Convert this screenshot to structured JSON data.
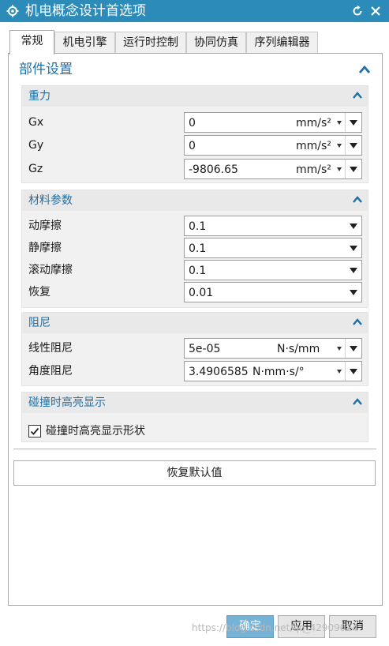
{
  "window": {
    "title": "机电概念设计首选项"
  },
  "tabs": [
    {
      "label": "常规"
    },
    {
      "label": "机电引擎"
    },
    {
      "label": "运行时控制"
    },
    {
      "label": "协同仿真"
    },
    {
      "label": "序列编辑器"
    }
  ],
  "active_tab": "常规",
  "section": {
    "title": "部件设置"
  },
  "gravity": {
    "title": "重力",
    "rows": [
      {
        "label": "Gx",
        "value": "0",
        "unit": "mm/s²"
      },
      {
        "label": "Gy",
        "value": "0",
        "unit": "mm/s²"
      },
      {
        "label": "Gz",
        "value": "-9806.65",
        "unit": "mm/s²"
      }
    ]
  },
  "material": {
    "title": "材料参数",
    "rows": [
      {
        "label": "动摩擦",
        "value": "0.1"
      },
      {
        "label": "静摩擦",
        "value": "0.1"
      },
      {
        "label": "滚动摩擦",
        "value": "0.1"
      },
      {
        "label": "恢复",
        "value": "0.01"
      }
    ]
  },
  "damping": {
    "title": "阻尼",
    "rows": [
      {
        "label": "线性阻尼",
        "value": "5e-05",
        "unit": "N·s/mm"
      },
      {
        "label": "角度阻尼",
        "value": "3.4906585",
        "unit": "N·mm·s/°"
      }
    ]
  },
  "collision": {
    "title": "碰撞时高亮显示",
    "checkbox_label": "碰撞时高亮显示形状",
    "checked": true
  },
  "restore_button": "恢复默认值",
  "footer": {
    "ok": "确定",
    "apply": "应用",
    "cancel": "取消"
  },
  "watermark": "https://blog.csdn.net/qq_42909024",
  "colors": {
    "title_bar": "#2c8bb8",
    "section_title": "#1c70a8",
    "ok_button": "#74b3d6"
  }
}
